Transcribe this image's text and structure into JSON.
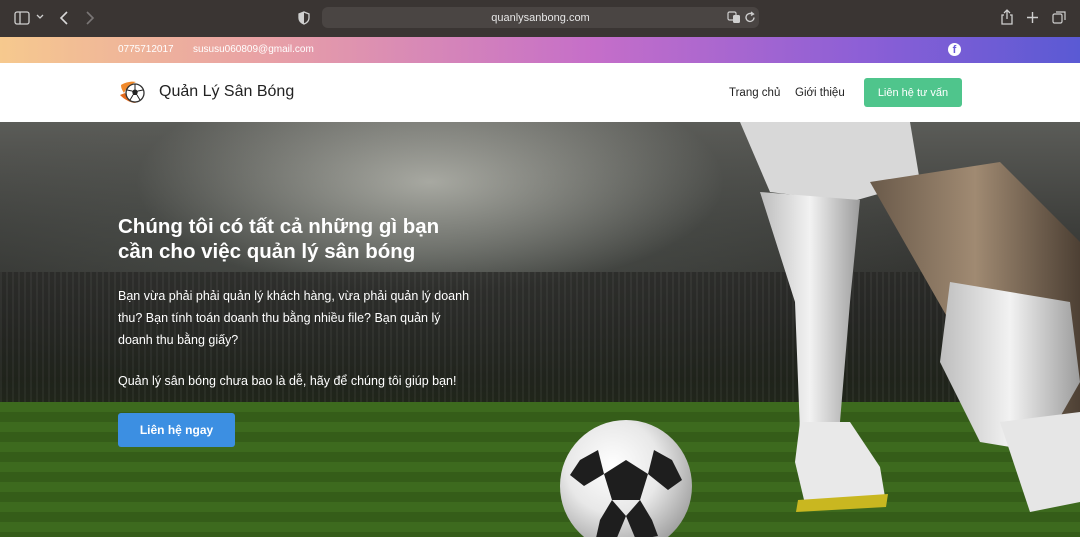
{
  "browser": {
    "url": "quanlysanbong.com"
  },
  "topbar": {
    "phone": "0775712017",
    "email": "sususu060809@gmail.com",
    "social_icon": "facebook-icon"
  },
  "header": {
    "brand": "Quản Lý Sân Bóng",
    "nav": [
      "Trang chủ",
      "Giới thiệu"
    ],
    "cta": "Liên hệ tư vấn"
  },
  "hero": {
    "title": "Chúng tôi có tất cả những gì bạn cần cho việc quản lý sân bóng",
    "paragraph": "Bạn vừa phải phải quản lý khách hàng, vừa phải quản lý doanh thu? Bạn tính toán doanh thu bằng nhiều file? Bạn quản lý doanh thu bằng giấy?",
    "paragraph2": "Quản lý sân bóng chưa bao là dễ, hãy để chúng tôi giúp bạn!",
    "cta": "Liên hệ ngay"
  },
  "colors": {
    "cta_green": "#4fc58c",
    "cta_blue": "#3c8fe2"
  }
}
